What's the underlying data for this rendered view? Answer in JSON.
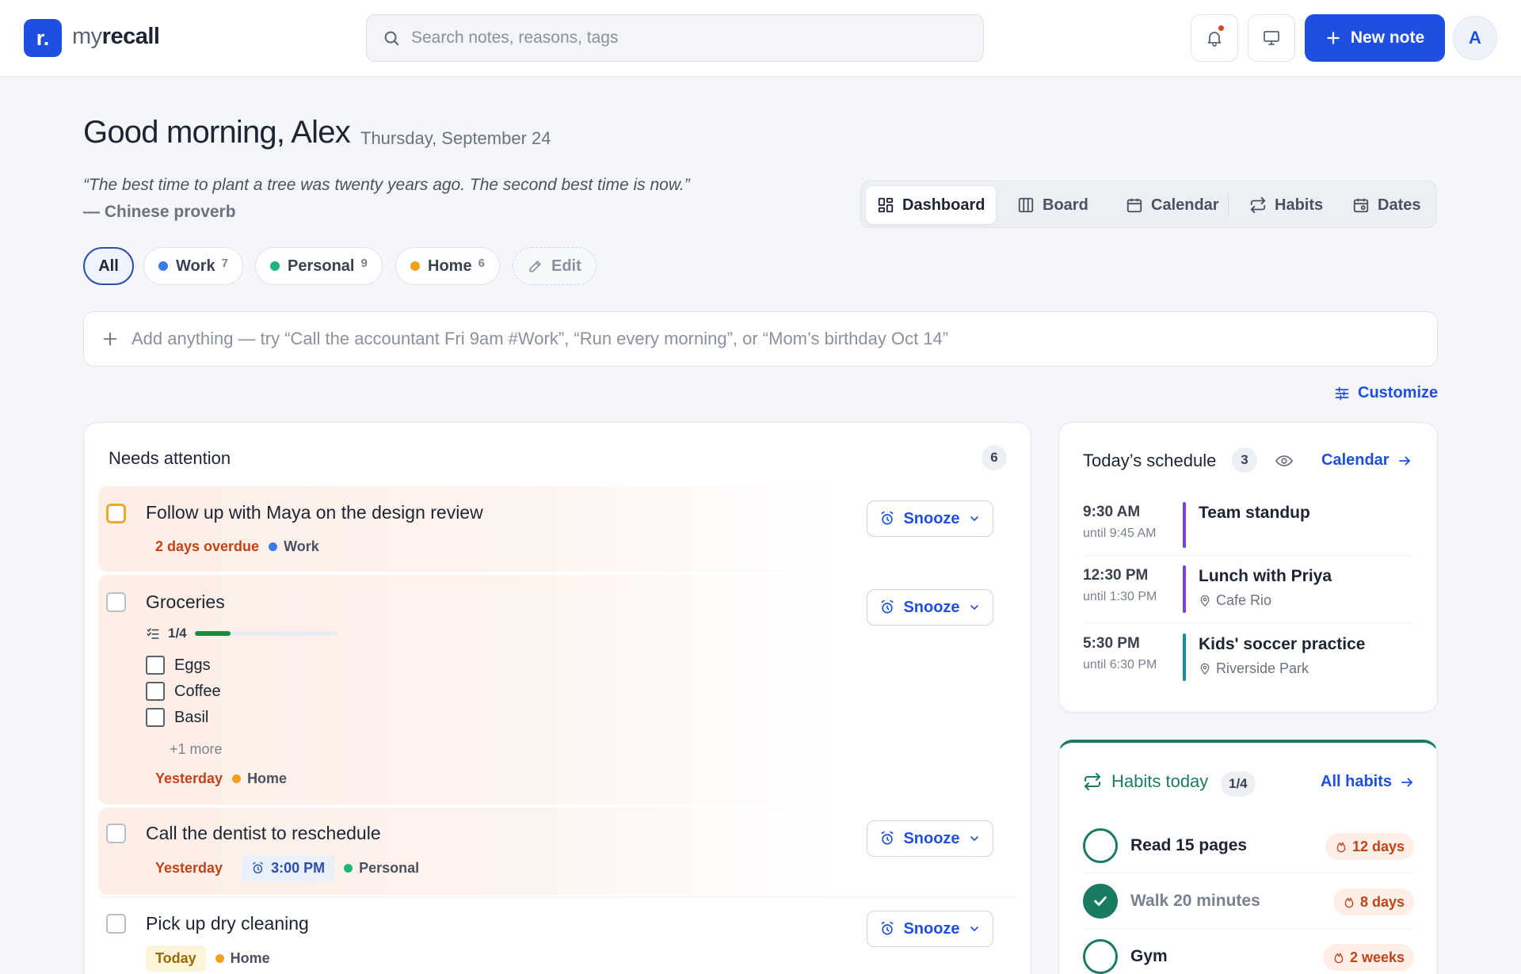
{
  "app": {
    "brand_prefix": "my",
    "brand_bold": "recall",
    "logo_letter": "r."
  },
  "search": {
    "placeholder": "Search notes, reasons, tags"
  },
  "header": {
    "new_note_label": "New note",
    "avatar_initial": "A"
  },
  "greeting": {
    "text": "Good morning, Alex",
    "date": "Thursday, September 24"
  },
  "quote": {
    "text": "“The best time to plant a tree was twenty years ago. The second best time is now.”",
    "author": "— Chinese proverb"
  },
  "views": {
    "dashboard": "Dashboard",
    "board": "Board",
    "calendar": "Calendar",
    "habits": "Habits",
    "dates": "Dates",
    "active": "Dashboard"
  },
  "filters": {
    "all": "All",
    "work": {
      "label": "Work",
      "count": "7",
      "color": "#3b7be8"
    },
    "personal": {
      "label": "Personal",
      "count": "9",
      "color": "#1fb57a"
    },
    "home": {
      "label": "Home",
      "count": "6",
      "color": "#f0a020"
    },
    "edit": "Edit"
  },
  "quick_add": {
    "placeholder": "Add anything — try “Call the accountant Fri 9am #Work”, “Run every morning”, or “Mom’s birthday Oct 14”"
  },
  "customize_label": "Customize",
  "attention": {
    "title": "Needs attention",
    "count": "6",
    "snooze_label": "Snooze",
    "tasks": [
      {
        "title": "Follow up with Maya on the design review",
        "when": "2 days overdue",
        "tag": "Work"
      },
      {
        "title": "Groceries",
        "progress_text": "1/4",
        "progress": 0.25,
        "items": [
          "Eggs",
          "Coffee",
          "Basil"
        ],
        "more": "+1 more",
        "when": "Yesterday",
        "tag": "Home"
      },
      {
        "title": "Call the dentist to reschedule",
        "when": "Yesterday",
        "time": "3:00 PM",
        "tag": "Personal"
      },
      {
        "title": "Pick up dry cleaning",
        "when": "Today",
        "tag": "Home"
      }
    ]
  },
  "schedule": {
    "title": "Today’s schedule",
    "count": "3",
    "link": "Calendar",
    "events": [
      {
        "time": "9:30 AM",
        "until": "until 9:45 AM",
        "title": "Team standup",
        "color": "#7b3fe4"
      },
      {
        "time": "12:30 PM",
        "until": "until 1:30 PM",
        "title": "Lunch with Priya",
        "location": "Cafe Rio",
        "color": "#7b3fe4"
      },
      {
        "time": "5:30 PM",
        "until": "until 6:30 PM",
        "title": "Kids' soccer practice",
        "location": "Riverside Park",
        "color": "#1b8a9c"
      }
    ]
  },
  "habits": {
    "title": "Habits today",
    "count": "1/4",
    "link": "All habits",
    "items": [
      {
        "name": "Read 15 pages",
        "streak": "12 days",
        "done": false
      },
      {
        "name": "Walk 20 minutes",
        "streak": "8 days",
        "done": true
      },
      {
        "name": "Gym",
        "streak": "2 weeks",
        "done": false
      }
    ]
  }
}
